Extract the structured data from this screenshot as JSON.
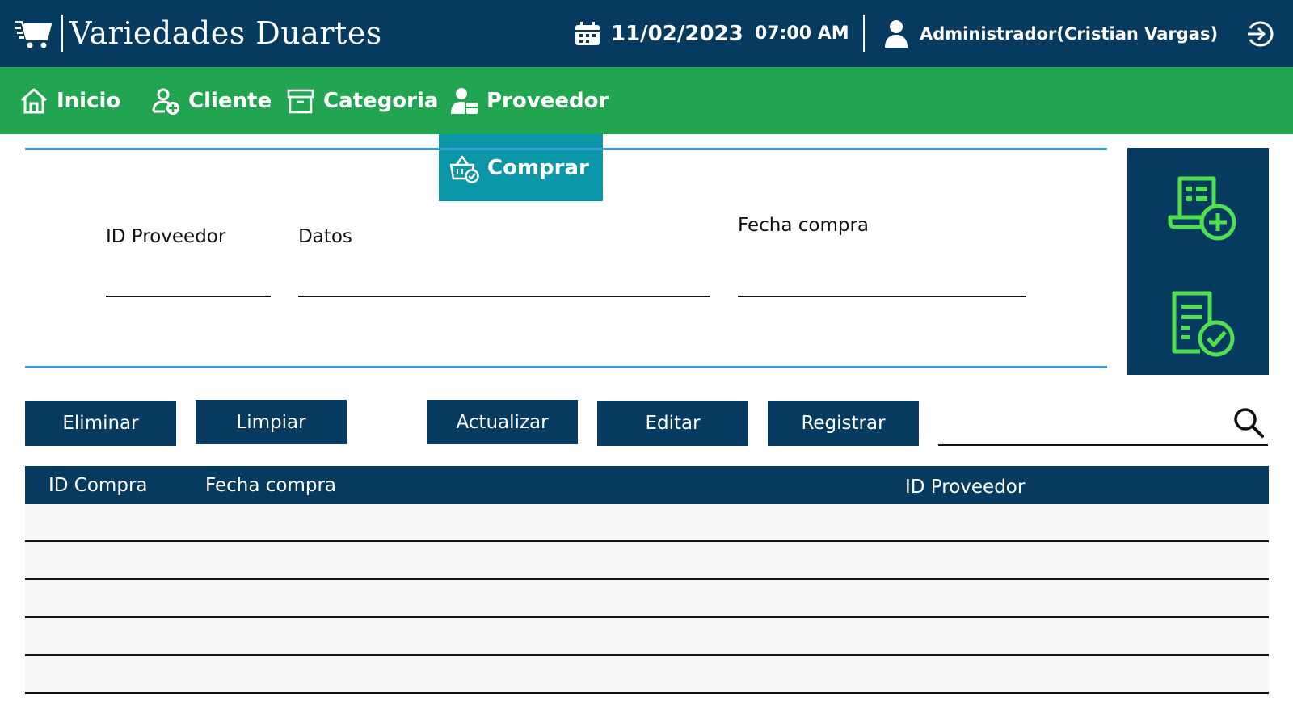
{
  "header": {
    "app_title": "Variedades Duartes",
    "date": "11/02/2023",
    "time": "07:00 AM",
    "user": "Administrador(Cristian Vargas)",
    "background_color": "#063b5f",
    "icons": [
      "shopping-cart-icon",
      "calendar-icon",
      "user-icon",
      "logout-icon"
    ]
  },
  "nav": {
    "background_color": "#21a551",
    "items": [
      {
        "label": "Inicio",
        "icon": "home-icon"
      },
      {
        "label": "Cliente",
        "icon": "user-add-icon"
      },
      {
        "label": "Categoria",
        "icon": "archive-box-icon"
      },
      {
        "label": "Proveedor",
        "icon": "supplier-icon"
      }
    ],
    "active_tab": {
      "label": "Comprar",
      "icon": "basket-check-icon",
      "color": "#0c97a8"
    }
  },
  "form": {
    "id_proveedor": {
      "label": "ID Proveedor",
      "value": ""
    },
    "datos": {
      "label": "Datos",
      "value": ""
    },
    "fecha_compra": {
      "label": "Fecha compra",
      "value": ""
    },
    "rule_color": "#3a9bd5"
  },
  "side_panel": {
    "buttons": [
      {
        "name": "add-purchase",
        "icon": "invoice-add-icon"
      },
      {
        "name": "confirm-purchase",
        "icon": "invoice-check-icon"
      }
    ],
    "icon_color": "#4fe04f"
  },
  "actions": {
    "eliminar": "Eliminar",
    "limpiar": "Limpiar",
    "actualizar": "Actualizar",
    "editar": "Editar",
    "registrar": "Registrar"
  },
  "search": {
    "value": "",
    "placeholder": ""
  },
  "table": {
    "columns": [
      "ID Compra",
      "Fecha compra",
      "ID Proveedor"
    ],
    "rows": [
      [],
      [],
      [],
      [],
      []
    ]
  }
}
